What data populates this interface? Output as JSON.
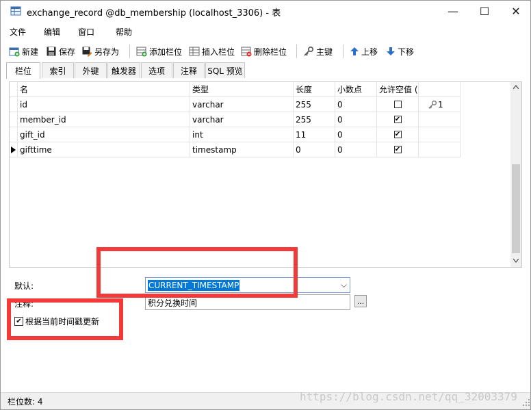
{
  "window": {
    "title": "exchange_record @db_membership (localhost_3306) - 表",
    "minimize": "—",
    "maximize": "☐",
    "close": "✕"
  },
  "menu": [
    "文件",
    "编辑",
    "窗口",
    "帮助"
  ],
  "toolbar": {
    "new": "新建",
    "save": "保存",
    "save_as": "另存为",
    "add_field": "添加栏位",
    "insert_field": "插入栏位",
    "delete_field": "删除栏位",
    "primary_key": "主键",
    "move_up": "上移",
    "move_down": "下移"
  },
  "tabs": [
    "栏位",
    "索引",
    "外键",
    "触发器",
    "选项",
    "注释",
    "SQL 预览"
  ],
  "grid": {
    "headers": [
      "名",
      "类型",
      "长度",
      "小数点",
      "允许空值 ("
    ],
    "rows": [
      {
        "name": "id",
        "type": "varchar",
        "length": "255",
        "decimal": "0",
        "nullable": false,
        "key": "1"
      },
      {
        "name": "member_id",
        "type": "varchar",
        "length": "255",
        "decimal": "0",
        "nullable": true,
        "key": ""
      },
      {
        "name": "gift_id",
        "type": "int",
        "length": "11",
        "decimal": "0",
        "nullable": true,
        "key": ""
      },
      {
        "name": "gifttime",
        "type": "timestamp",
        "length": "0",
        "decimal": "0",
        "nullable": true,
        "key": ""
      }
    ]
  },
  "properties": {
    "default_label": "默认:",
    "default_value": "CURRENT_TIMESTAMP",
    "comment_label": "注释:",
    "comment_value": "积分兑换时间",
    "ellipsis": "...",
    "update_checkbox_label": "根据当前时间戳更新",
    "update_checked": true
  },
  "status": {
    "field_count": "栏位数: 4"
  },
  "watermark": "https://blog.csdn.net/qq_32003379",
  "colors": {
    "highlight_box": "#f23a3a",
    "selection": "#0078d7"
  }
}
